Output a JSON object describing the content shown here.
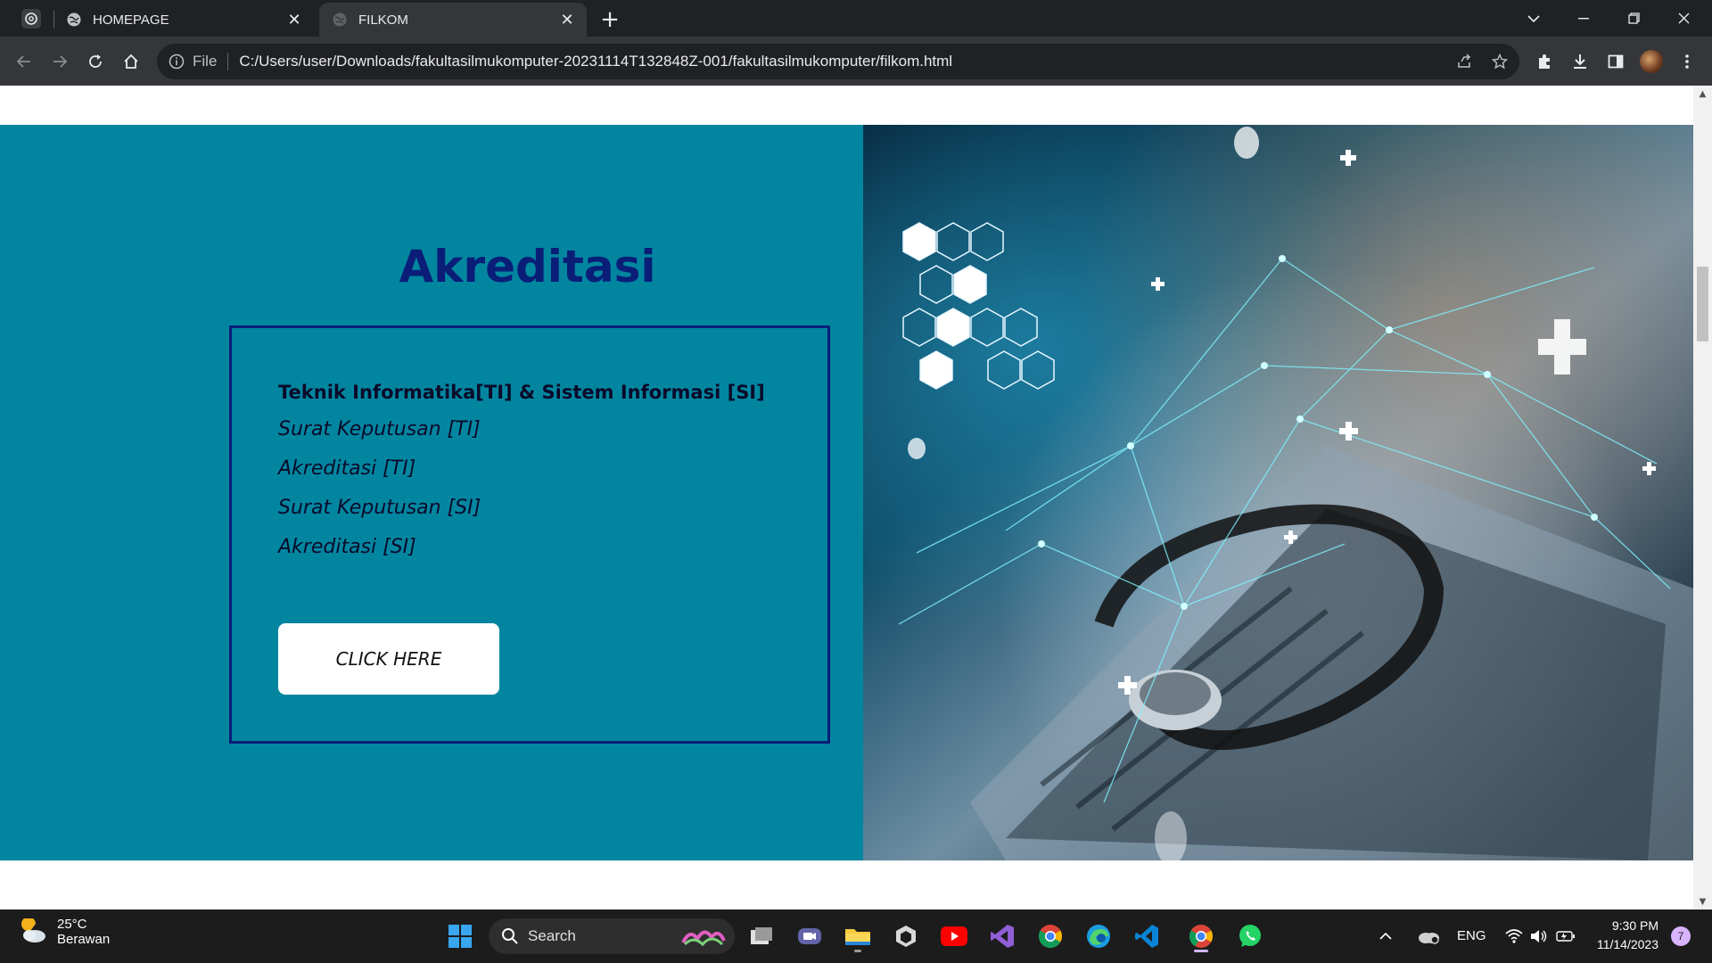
{
  "browser": {
    "tabs": [
      {
        "label": "HOMEPAGE",
        "active": false
      },
      {
        "label": "FILKOM",
        "active": true
      }
    ],
    "omnibox": {
      "scheme_label": "File",
      "url": "C:/Users/user/Downloads/fakultasilmukomputer-20231114T132848Z-001/fakultasilmukomputer/filkom.html"
    },
    "icons": [
      "back-icon",
      "forward-icon",
      "reload-icon",
      "home-icon",
      "info-icon",
      "share-icon",
      "star-icon",
      "extensions-icon",
      "download-icon",
      "sidepanel-icon",
      "profile-avatar",
      "menu-icon"
    ]
  },
  "page": {
    "heading": "Akreditasi",
    "box": {
      "title": "Teknik Informatika[TI] & Sistem Informasi [SI]",
      "links": [
        "Surat Keputusan [TI]",
        "Akreditasi [TI]",
        "Surat Keputusan [SI]",
        "Akreditasi [SI]"
      ],
      "button": "CLICK HERE"
    },
    "colors": {
      "panel": "#0286a0",
      "heading": "#0a1e78",
      "border": "#0a1e78"
    }
  },
  "taskbar": {
    "weather": {
      "temp": "25°C",
      "condition": "Berawan"
    },
    "search_placeholder": "Search",
    "language": "ENG",
    "time": "9:30 PM",
    "date": "11/14/2023",
    "notification_count": "7"
  }
}
